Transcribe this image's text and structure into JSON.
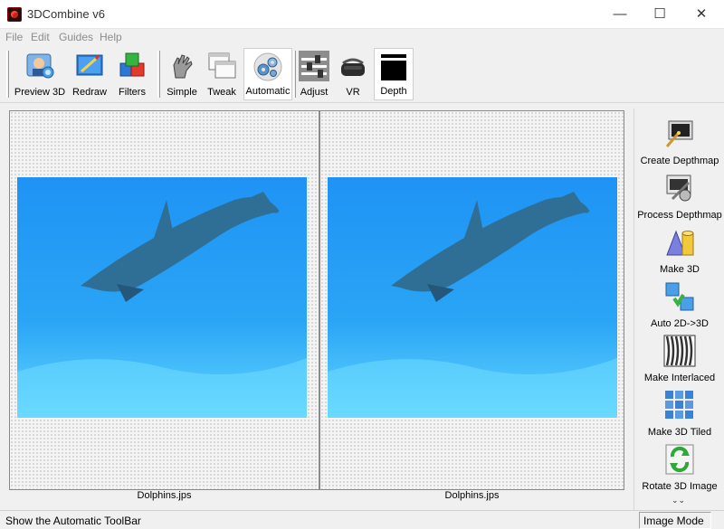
{
  "window": {
    "title": "3DCombine v6",
    "minimize_glyph": "—",
    "maximize_glyph": "☐",
    "close_glyph": "✕"
  },
  "menu": [
    "File",
    "Edit",
    "Guides",
    "Help"
  ],
  "toolbar": [
    {
      "label": "Preview 3D",
      "icon": "preview-3d-icon"
    },
    {
      "label": "Redraw",
      "icon": "redraw-icon"
    },
    {
      "label": "Filters",
      "icon": "filters-icon"
    },
    {
      "label": "Simple",
      "icon": "simple-hand-icon"
    },
    {
      "label": "Tweak",
      "icon": "tweak-windows-icon"
    },
    {
      "label": "Automatic",
      "icon": "automatic-gears-icon"
    },
    {
      "label": "Adjust",
      "icon": "adjust-sliders-icon"
    },
    {
      "label": "VR",
      "icon": "vr-headset-icon"
    },
    {
      "label": "Depth",
      "icon": "depth-icon"
    }
  ],
  "images": [
    {
      "caption": "Dolphins.jps"
    },
    {
      "caption": "Dolphins.jps"
    }
  ],
  "side_tools": [
    {
      "label": "Create Depthmap",
      "icon": "create-depthmap-icon"
    },
    {
      "label": "Process Depthmap",
      "icon": "process-depthmap-icon"
    },
    {
      "label": "Make 3D",
      "icon": "make-3d-icon"
    },
    {
      "label": "Auto 2D->3D",
      "icon": "auto-2d-3d-icon"
    },
    {
      "label": "Make Interlaced",
      "icon": "make-interlaced-icon"
    },
    {
      "label": "Make 3D Tiled",
      "icon": "make-3d-tiled-icon"
    },
    {
      "label": "Rotate 3D Image",
      "icon": "rotate-3d-image-icon"
    }
  ],
  "more_glyph": "⌄⌄",
  "status": {
    "message": "Show the Automatic ToolBar",
    "mode": "Image Mode"
  },
  "colors": {
    "water": "#1b8cf0",
    "dolphin": "#2f6f95"
  }
}
